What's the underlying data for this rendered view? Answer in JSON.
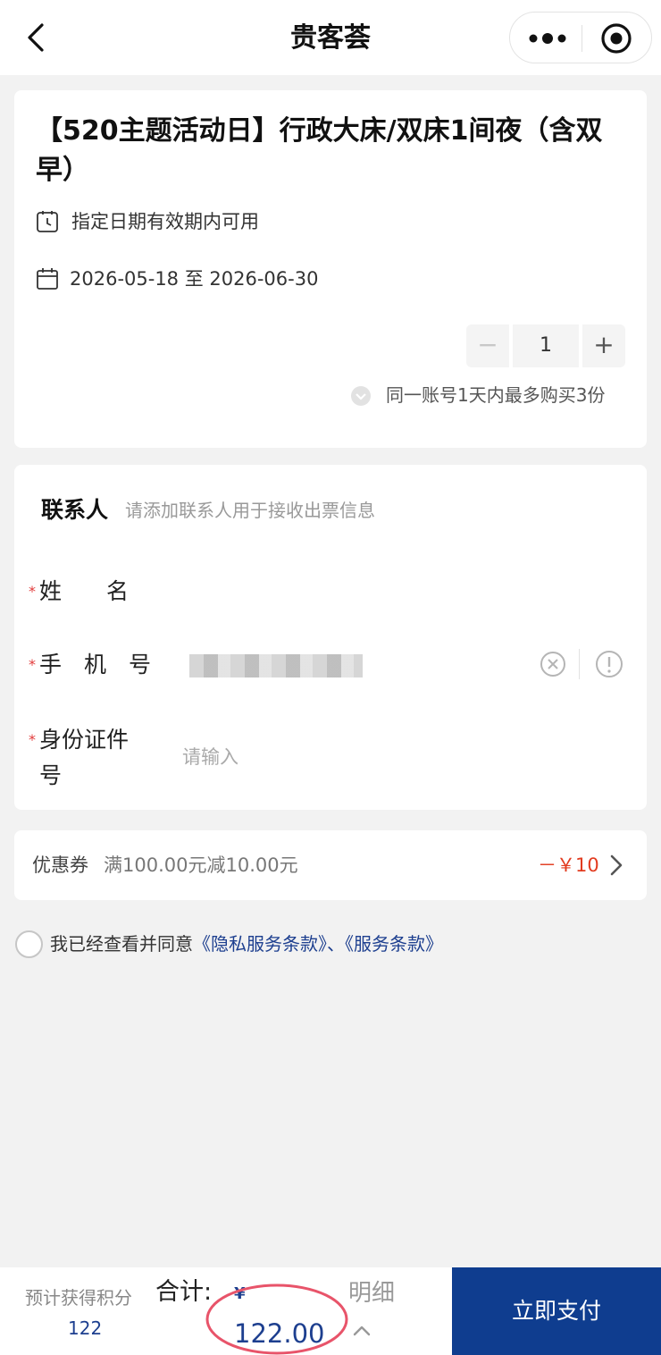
{
  "nav": {
    "title": "贵客荟",
    "back_icon": "chevron-left-icon",
    "more_icon": "more-dots-icon",
    "close_icon": "target-circle-icon"
  },
  "product": {
    "title": "【520主题活动日】行政大床/双床1间夜（含双早）",
    "validity": "指定日期有效期内可用",
    "date_range": "2026-05-18 至 2026-06-30",
    "quantity": "1",
    "minus_label": "−",
    "plus_label": "+",
    "limit_note": "同一账号1天内最多购买3份"
  },
  "contact": {
    "title": "联系人",
    "hint": "请添加联系人用于接收出票信息",
    "fields": {
      "name_label": "姓　　名",
      "phone_label": "手　机　号",
      "id_label_line1": "身份证件",
      "id_label_line2": "号",
      "id_placeholder": "请输入",
      "required_mark": "*"
    }
  },
  "coupon": {
    "label": "优惠券",
    "description": "满100.00元减10.00元",
    "amount": "－￥10"
  },
  "agreement": {
    "prefix": "我已经查看并同意",
    "privacy_link": "《隐私服务条款》",
    "separator": "、",
    "service_link": "《服务条款》"
  },
  "footer": {
    "points_label": "预计获得积分",
    "points_value": "122",
    "total_label": "合计:",
    "currency": "¥",
    "total_value": "122.00",
    "detail_label": "明细",
    "pay_label": "立即支付"
  },
  "colors": {
    "brand": "#0f3d8f",
    "link": "#1d3f8f",
    "discount": "#e23b1f",
    "highlight_ellipse": "#e8546a"
  }
}
